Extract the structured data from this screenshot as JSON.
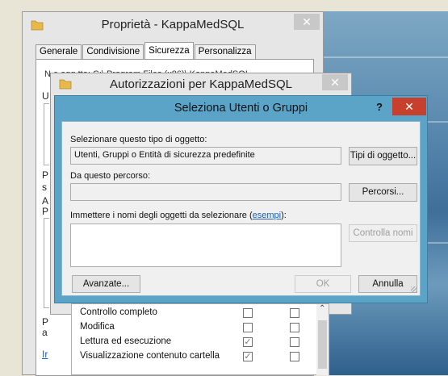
{
  "properties_window": {
    "title": "Proprietà - KappaMedSQL",
    "tabs": [
      "Generale",
      "Condivisione",
      "Sicurezza",
      "Personalizza"
    ],
    "partial_text": "N          e ogg  tto: C:\\ Program Files (x86)\\ KappaMedSQL",
    "partial_letters": [
      "U",
      "P",
      "s",
      "A",
      "P",
      "P",
      "a",
      "Ir"
    ]
  },
  "permissions_window": {
    "title": "Autorizzazioni per KappaMedSQL"
  },
  "select_dialog": {
    "title": "Seleziona Utenti o Gruppi",
    "help": "?",
    "object_type_label": "Selezionare questo tipo di oggetto:",
    "object_type_value": "Utenti, Gruppi o Entità di sicurezza predefinite",
    "object_types_button": "Tipi di oggetto...",
    "location_label": "Da questo percorso:",
    "location_value": "",
    "locations_button": "Percorsi...",
    "names_label_prefix": "Immettere i nomi degli oggetti da selezionare (",
    "names_label_link": "esempi",
    "names_label_suffix": "):",
    "check_names_button": "Controlla nomi",
    "advanced_button": "Avanzate...",
    "ok_button": "OK",
    "cancel_button": "Annulla"
  },
  "permissions_list": [
    {
      "name": "Controllo completo",
      "allow": false,
      "deny": false
    },
    {
      "name": "Modifica",
      "allow": false,
      "deny": false
    },
    {
      "name": "Lettura ed esecuzione",
      "allow": true,
      "deny": false
    },
    {
      "name": "Visualizzazione contenuto cartella",
      "allow": true,
      "deny": false
    }
  ],
  "colors": {
    "dialog_titlebar": "#5ba3c7",
    "close_red": "#c7402e"
  },
  "icons": [
    "folder-icon",
    "close-icon",
    "help-icon",
    "checkmark-icon",
    "scroll-up-icon"
  ]
}
